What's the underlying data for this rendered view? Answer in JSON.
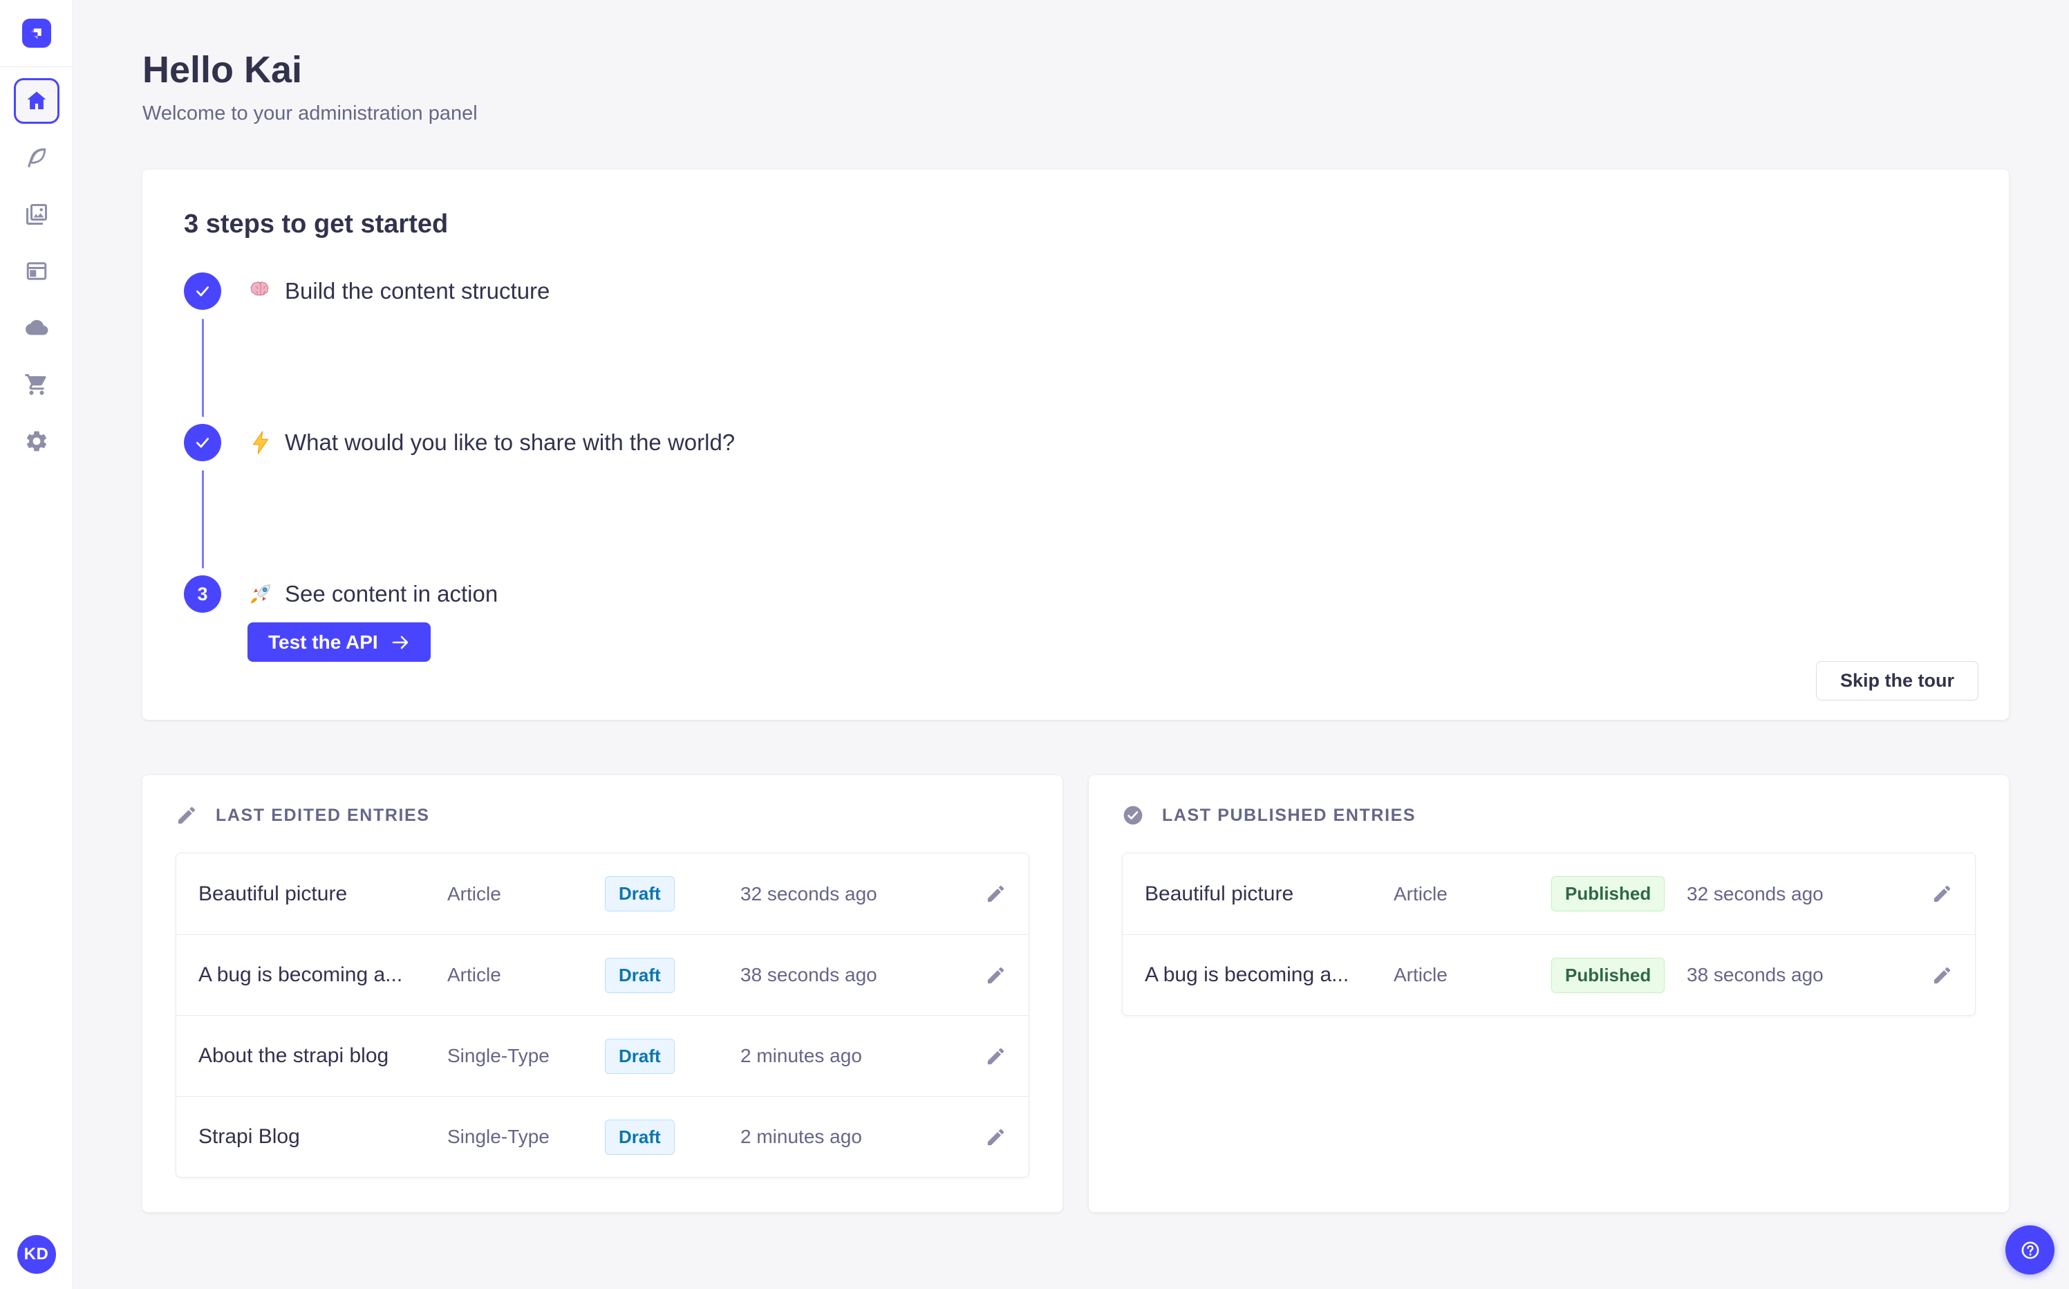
{
  "colors": {
    "accent": "#4945ff",
    "accent_light": "#7b79ff",
    "background": "#f6f6f9",
    "text": "#32324d",
    "text_secondary": "#666687",
    "icon": "#8e8ea9",
    "border": "#eaeaef",
    "draft_bg": "#eaf5ff",
    "draft_border": "#b8e1ff",
    "draft_text": "#0c75af",
    "published_bg": "#eafbe7",
    "published_border": "#c6f0c2",
    "published_text": "#2f6846"
  },
  "sidebar": {
    "logo_icon": "strapi-logo",
    "items": [
      {
        "icon": "home-icon",
        "active": true
      },
      {
        "icon": "feather-icon",
        "active": false
      },
      {
        "icon": "media-library-icon",
        "active": false
      },
      {
        "icon": "content-manager-icon",
        "active": false
      },
      {
        "icon": "cloud-icon",
        "active": false
      },
      {
        "icon": "marketplace-cart-icon",
        "active": false
      },
      {
        "icon": "settings-gear-icon",
        "active": false
      }
    ],
    "avatar_initials": "KD"
  },
  "header": {
    "title": "Hello Kai",
    "subtitle": "Welcome to your administration panel"
  },
  "onboarding": {
    "title": "3 steps to get started",
    "steps": [
      {
        "icon": "brain-emoji",
        "label": "Build the content structure",
        "state": "done"
      },
      {
        "icon": "lightning-emoji",
        "label": "What would you like to share with the world?",
        "state": "done"
      },
      {
        "icon": "rocket-emoji",
        "label": "See content in action",
        "state": "current",
        "number": "3"
      }
    ],
    "test_api_label": "Test the API",
    "skip_label": "Skip the tour"
  },
  "widgets": {
    "edited": {
      "title": "LAST EDITED ENTRIES",
      "icon": "pencil-icon",
      "rows": [
        {
          "name": "Beautiful picture",
          "kind": "Article",
          "status": "Draft",
          "time": "32 seconds ago"
        },
        {
          "name": "A bug is becoming a...",
          "kind": "Article",
          "status": "Draft",
          "time": "38 seconds ago"
        },
        {
          "name": "About the strapi blog",
          "kind": "Single-Type",
          "status": "Draft",
          "time": "2 minutes ago"
        },
        {
          "name": "Strapi Blog",
          "kind": "Single-Type",
          "status": "Draft",
          "time": "2 minutes ago"
        }
      ]
    },
    "published": {
      "title": "LAST PUBLISHED ENTRIES",
      "icon": "check-circle-icon",
      "rows": [
        {
          "name": "Beautiful picture",
          "kind": "Article",
          "status": "Published",
          "time": "32 seconds ago"
        },
        {
          "name": "A bug is becoming a...",
          "kind": "Article",
          "status": "Published",
          "time": "38 seconds ago"
        }
      ]
    }
  }
}
